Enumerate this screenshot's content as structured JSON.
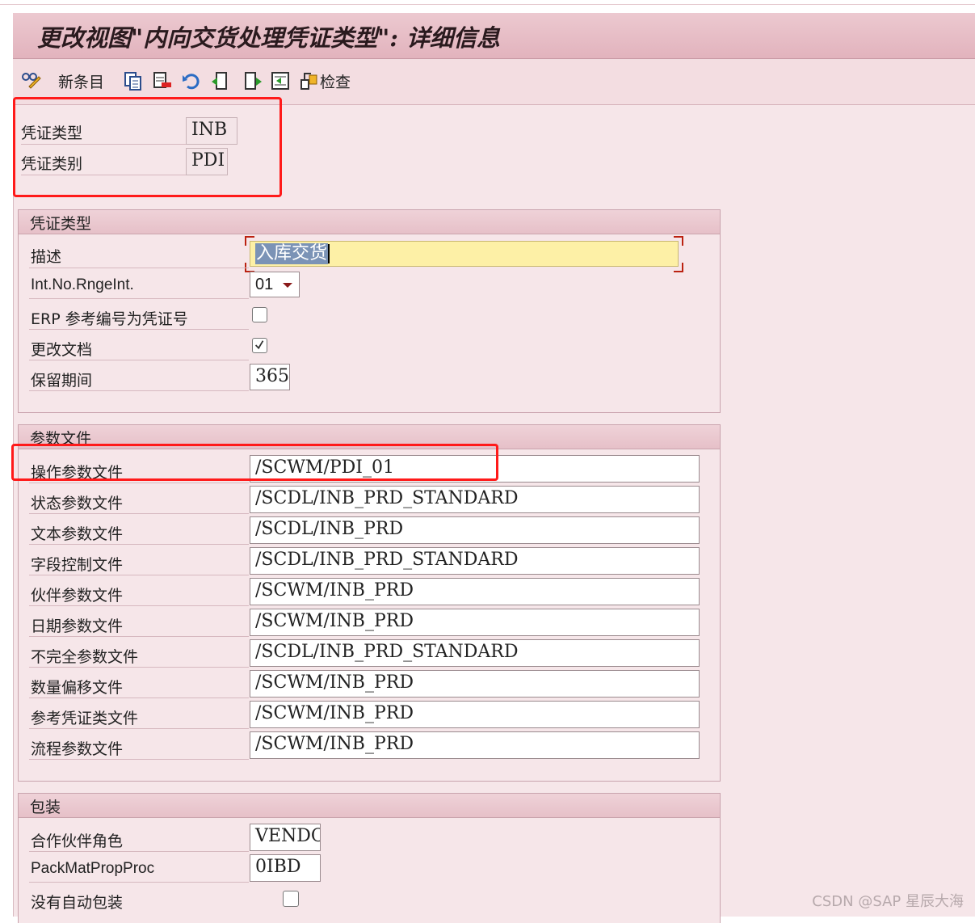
{
  "window": {
    "title": "更改视图\"内向交货处理凭证类型\": 详细信息"
  },
  "toolbar": {
    "new_entries_label": "新条目",
    "check_label": "检查"
  },
  "header": {
    "doc_type_label": "凭证类型",
    "doc_type_value": "INB",
    "doc_category_label": "凭证类别",
    "doc_category_value": "PDI"
  },
  "group_doc_type": {
    "title": "凭证类型",
    "desc_label": "描述",
    "desc_value": "入库交货",
    "int_no_label": "Int.No.RngeInt.",
    "int_no_value": "01",
    "erp_ref_label": "ERP 参考编号为凭证号",
    "erp_ref_checked": false,
    "change_docs_label": "更改文档",
    "change_docs_checked": true,
    "retention_label": "保留期间",
    "retention_value": "365"
  },
  "group_profiles": {
    "title": "参数文件",
    "rows": [
      {
        "label": "操作参数文件",
        "value": "/SCWM/PDI_01"
      },
      {
        "label": "状态参数文件",
        "value": "/SCDL/INB_PRD_STANDARD"
      },
      {
        "label": "文本参数文件",
        "value": "/SCDL/INB_PRD"
      },
      {
        "label": "字段控制文件",
        "value": "/SCDL/INB_PRD_STANDARD"
      },
      {
        "label": "伙伴参数文件",
        "value": "/SCWM/INB_PRD"
      },
      {
        "label": "日期参数文件",
        "value": "/SCWM/INB_PRD"
      },
      {
        "label": "不完全参数文件",
        "value": "/SCDL/INB_PRD_STANDARD"
      },
      {
        "label": "数量偏移文件",
        "value": "/SCWM/INB_PRD"
      },
      {
        "label": "参考凭证类文件",
        "value": "/SCWM/INB_PRD"
      },
      {
        "label": "流程参数文件",
        "value": "/SCWM/INB_PRD"
      }
    ]
  },
  "group_packing": {
    "title": "包装",
    "partner_role_label": "合作伙伴角色",
    "partner_role_value": "VENDOR",
    "packmat_label": "PackMatPropProc",
    "packmat_value": "0IBD",
    "no_auto_pack_label": "没有自动包装",
    "no_auto_pack_checked": false
  },
  "watermark": "CSDN @SAP 星辰大海",
  "colors": {
    "highlight_red": "#ff1a1a",
    "focus_yellow": "#fdf0a6",
    "frame_pink": "#f6e6e9"
  }
}
